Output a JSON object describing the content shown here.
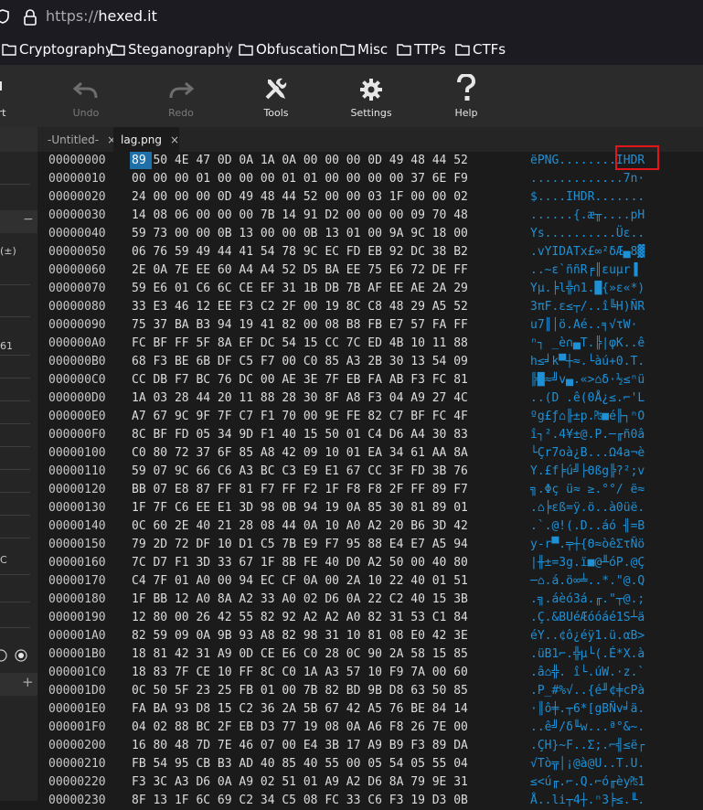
{
  "browser": {
    "url_prefix": "https://",
    "url_host": "hexed.it",
    "icons": [
      "shield-icon",
      "lock-icon"
    ]
  },
  "bookmarks": [
    {
      "label": "Cryptography"
    },
    {
      "label": "Steganography"
    },
    {
      "label": "Obfuscation"
    },
    {
      "label": "Misc"
    },
    {
      "label": "TTPs"
    },
    {
      "label": "CTFs"
    }
  ],
  "toolbar": {
    "partial_label": "rt",
    "undo": "Undo",
    "redo": "Redo",
    "tools": "Tools",
    "settings": "Settings",
    "help": "Help"
  },
  "tabs": [
    {
      "label": "-Untitled-",
      "close": "×"
    },
    {
      "label": "lag.png",
      "close": "×"
    }
  ],
  "sidebar": {
    "t1": "(±)",
    "t2": "61",
    "t3": "C",
    "minus": "−",
    "plus": "+"
  },
  "hex": {
    "selected_byte": "89",
    "rows": [
      {
        "off": "00000000",
        "bytes": "   50 4E 47 0D 0A 1A 0A 00 00 00 0D 49 48 44 52",
        "ascii": "ëPNG........IHDR"
      },
      {
        "off": "00000010",
        "bytes": "00 00 00 01 00 00 00 01 01 00 00 00 00 37 6E F9",
        "ascii": ".............7n·"
      },
      {
        "off": "00000020",
        "bytes": "24 00 00 00 0D 49 48 44 52 00 00 03 1F 00 00 02",
        "ascii": "$....IHDR......."
      },
      {
        "off": "00000030",
        "bytes": "14 08 06 00 00 00 7B 14 91 D2 00 00 00 09 70 48",
        "ascii": "......{.æ╥....pH"
      },
      {
        "off": "00000040",
        "bytes": "59 73 00 00 0B 13 00 00 0B 13 01 00 9A 9C 18 00",
        "ascii": "Ys..........Üε.."
      },
      {
        "off": "00000050",
        "bytes": "06 76 59 49 44 41 54 78 9C EC FD EB 92 DC 38 B2",
        "ascii": ".vYIDATx£∞²δÆ▄8▓"
      },
      {
        "off": "00000060",
        "bytes": "2E 0A 7E EE 60 A4 A4 52 D5 BA EE 75 E6 72 DE FF",
        "ascii": "..~ε`ññR╒║εuµr▐ "
      },
      {
        "off": "00000070",
        "bytes": "59 E6 01 C6 6C CE EF 31 1B DB 7B AF EE AE 2A 29",
        "ascii": "Yµ.╞l╬∩1.█{»ε«*)"
      },
      {
        "off": "00000080",
        "bytes": "33 E3 46 12 EE F3 C2 2F 00 19 8C C8 48 29 A5 52",
        "ascii": "3πF.ε≤┬/..î╚H)ÑR"
      },
      {
        "off": "00000090",
        "bytes": "75 37 BA B3 94 19 41 82 00 08 B8 FB E7 57 FA FF",
        "ascii": "u7║│ö.Aé..╕√τW· "
      },
      {
        "off": "000000A0",
        "bytes": "FC BF FF 5F 8A EF DC 54 15 CC 7C ED 4B 10 11 88",
        "ascii": "ⁿ┐ _è∩▄T.╠|φK..ê"
      },
      {
        "off": "000000B0",
        "bytes": "68 F3 BE 6B DF C5 F7 00 C0 85 A3 2B 30 13 54 09",
        "ascii": "h≤╛k▀┼≈.└àú+0.T."
      },
      {
        "off": "000000C0",
        "bytes": "CC DB F7 BC 76 DC 00 AE 3E 7F EB FA AB F3 FC 81",
        "ascii": "╠█≈╝v▄.«>⌂δ·½≤ⁿü"
      },
      {
        "off": "000000D0",
        "bytes": "1A 03 28 44 20 11 88 28 30 8F A8 F3 04 A9 27 4C",
        "ascii": "..(D .ê(0Å¿≤.⌐'L"
      },
      {
        "off": "000000E0",
        "bytes": "A7 67 9C 9F 7F C7 F1 70 00 9E FE 82 C7 BF FC 4F",
        "ascii": "ºg£ƒ⌂╟±p.₧■é╟┐ⁿO"
      },
      {
        "off": "000000F0",
        "bytes": "8C BF FD 05 34 9D F1 40 15 50 01 C4 D6 A4 30 83",
        "ascii": "î┐².4¥±@.P.─╓ñ0â"
      },
      {
        "off": "00000100",
        "bytes": "C0 80 72 37 6F 85 A8 42 09 10 01 EA 34 61 AA 8A",
        "ascii": "└Çr7oà¿B...Ω4a¬è"
      },
      {
        "off": "00000110",
        "bytes": "59 07 9C 66 C6 A3 BC C3 E9 E1 67 CC 3F FD 3B 76",
        "ascii": "Y.£f╞ú╝├Θßg╠?²;v"
      },
      {
        "off": "00000120",
        "bytes": "BB 07 E8 87 FF 81 F7 FF F2 1F F8 F8 2F FF 89 F7",
        "ascii": "╗.Φç ü≈ ≥.°°/ ë≈"
      },
      {
        "off": "00000130",
        "bytes": "1F 7F C6 EE E1 3D 98 0B 94 19 0A 85 30 81 89 01",
        "ascii": ".⌂╞εß=ÿ.ö..à0üë."
      },
      {
        "off": "00000140",
        "bytes": "0C 60 2E 40 21 28 08 44 0A 10 A0 A2 20 B6 3D 42",
        "ascii": ".`.@!(.D..áó ╢=B"
      },
      {
        "off": "00000150",
        "bytes": "79 2D 72 DF 10 D1 C5 7B E9 F7 95 88 E4 E7 A5 94",
        "ascii": "y-r▀.╤┼{Θ≈òêΣτÑö"
      },
      {
        "off": "00000160",
        "bytes": "7C D7 F1 3D 33 67 1F 8B FE 40 D0 A2 50 00 40 80",
        "ascii": "|╫±=3g.ï■@╨óP.@Ç"
      },
      {
        "off": "00000170",
        "bytes": "C4 7F 01 A0 00 94 EC CF 0A 00 2A 10 22 40 01 51",
        "ascii": "─⌂.á.ö∞╧..*.\"@.Q"
      },
      {
        "off": "00000180",
        "bytes": "1F BB 12 A0 8A A2 33 A0 02 D6 0A 22 C2 40 15 3B",
        "ascii": ".╗.áèó3á.╓.\"┬@.;"
      },
      {
        "off": "00000190",
        "bytes": "12 80 00 26 42 55 82 92 A2 A2 A0 82 31 53 C1 84",
        "ascii": ".Ç.&BUéÆóóáé1S┴ä"
      },
      {
        "off": "000001A0",
        "bytes": "82 59 09 0A 9B 93 A8 82 98 31 10 81 08 E0 42 3E",
        "ascii": "éY..¢ô¿éÿ1.ü.αB>"
      },
      {
        "off": "000001B0",
        "bytes": "18 81 42 31 A9 0D CE E6 C0 28 0C 90 2A 58 15 85",
        "ascii": ".üB1⌐.╬µ└(.É*X.à"
      },
      {
        "off": "000001C0",
        "bytes": "18 83 7F CE 10 FF 8C C0 1A A3 57 10 F9 7A 00 60",
        "ascii": ".â⌂╬. î└.úW.·z.`"
      },
      {
        "off": "000001D0",
        "bytes": "0C 50 5F 23 25 FB 01 00 7B 82 BD 9B D8 63 50 85",
        "ascii": ".P_#%√..{é╜¢╪cPà"
      },
      {
        "off": "000001E0",
        "bytes": "FA BA 93 D8 15 C2 36 2A 5B 67 42 A5 76 BE 84 14",
        "ascii": "·║ô╪.┬6*[gBÑv╛ä."
      },
      {
        "off": "000001F0",
        "bytes": "04 02 88 BC 2F EB D3 77 19 08 0A A6 F8 26 7E 00",
        "ascii": "..ê╝/δ╙w...ª°&~."
      },
      {
        "off": "00000200",
        "bytes": "16 80 48 7D 7E 46 07 00 E4 3B 17 A9 B9 F3 89 DA",
        "ascii": ".ÇH}~F..Σ;.⌐╣≤ë┌"
      },
      {
        "off": "00000210",
        "bytes": "FB 54 95 CB B3 AD 40 85 40 55 00 05 54 05 55 04",
        "ascii": "√Tò╦│¡@à@U..T.U."
      },
      {
        "off": "00000220",
        "bytes": "F3 3C A3 D6 0A A9 02 51 01 A9 A2 D6 8A 79 9E 31",
        "ascii": "≤<ú╓.⌐.Q.⌐ó╓èy₧1"
      },
      {
        "off": "00000230",
        "bytes": "8F 13 1F 6C 69 C2 34 C5 08 FC 33 C6 F3 19 D3 0B",
        "ascii": "Å..li┬4┼.ⁿ3╞≤.╙."
      }
    ]
  }
}
